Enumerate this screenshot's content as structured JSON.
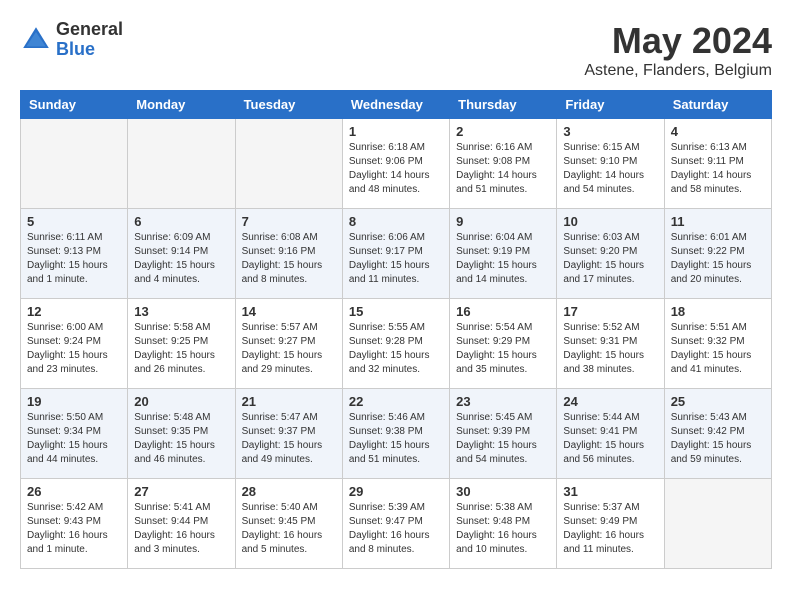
{
  "header": {
    "logo_general": "General",
    "logo_blue": "Blue",
    "month_title": "May 2024",
    "location": "Astene, Flanders, Belgium"
  },
  "days_of_week": [
    "Sunday",
    "Monday",
    "Tuesday",
    "Wednesday",
    "Thursday",
    "Friday",
    "Saturday"
  ],
  "weeks": [
    [
      {
        "day": "",
        "info": ""
      },
      {
        "day": "",
        "info": ""
      },
      {
        "day": "",
        "info": ""
      },
      {
        "day": "1",
        "info": "Sunrise: 6:18 AM\nSunset: 9:06 PM\nDaylight: 14 hours\nand 48 minutes."
      },
      {
        "day": "2",
        "info": "Sunrise: 6:16 AM\nSunset: 9:08 PM\nDaylight: 14 hours\nand 51 minutes."
      },
      {
        "day": "3",
        "info": "Sunrise: 6:15 AM\nSunset: 9:10 PM\nDaylight: 14 hours\nand 54 minutes."
      },
      {
        "day": "4",
        "info": "Sunrise: 6:13 AM\nSunset: 9:11 PM\nDaylight: 14 hours\nand 58 minutes."
      }
    ],
    [
      {
        "day": "5",
        "info": "Sunrise: 6:11 AM\nSunset: 9:13 PM\nDaylight: 15 hours\nand 1 minute."
      },
      {
        "day": "6",
        "info": "Sunrise: 6:09 AM\nSunset: 9:14 PM\nDaylight: 15 hours\nand 4 minutes."
      },
      {
        "day": "7",
        "info": "Sunrise: 6:08 AM\nSunset: 9:16 PM\nDaylight: 15 hours\nand 8 minutes."
      },
      {
        "day": "8",
        "info": "Sunrise: 6:06 AM\nSunset: 9:17 PM\nDaylight: 15 hours\nand 11 minutes."
      },
      {
        "day": "9",
        "info": "Sunrise: 6:04 AM\nSunset: 9:19 PM\nDaylight: 15 hours\nand 14 minutes."
      },
      {
        "day": "10",
        "info": "Sunrise: 6:03 AM\nSunset: 9:20 PM\nDaylight: 15 hours\nand 17 minutes."
      },
      {
        "day": "11",
        "info": "Sunrise: 6:01 AM\nSunset: 9:22 PM\nDaylight: 15 hours\nand 20 minutes."
      }
    ],
    [
      {
        "day": "12",
        "info": "Sunrise: 6:00 AM\nSunset: 9:24 PM\nDaylight: 15 hours\nand 23 minutes."
      },
      {
        "day": "13",
        "info": "Sunrise: 5:58 AM\nSunset: 9:25 PM\nDaylight: 15 hours\nand 26 minutes."
      },
      {
        "day": "14",
        "info": "Sunrise: 5:57 AM\nSunset: 9:27 PM\nDaylight: 15 hours\nand 29 minutes."
      },
      {
        "day": "15",
        "info": "Sunrise: 5:55 AM\nSunset: 9:28 PM\nDaylight: 15 hours\nand 32 minutes."
      },
      {
        "day": "16",
        "info": "Sunrise: 5:54 AM\nSunset: 9:29 PM\nDaylight: 15 hours\nand 35 minutes."
      },
      {
        "day": "17",
        "info": "Sunrise: 5:52 AM\nSunset: 9:31 PM\nDaylight: 15 hours\nand 38 minutes."
      },
      {
        "day": "18",
        "info": "Sunrise: 5:51 AM\nSunset: 9:32 PM\nDaylight: 15 hours\nand 41 minutes."
      }
    ],
    [
      {
        "day": "19",
        "info": "Sunrise: 5:50 AM\nSunset: 9:34 PM\nDaylight: 15 hours\nand 44 minutes."
      },
      {
        "day": "20",
        "info": "Sunrise: 5:48 AM\nSunset: 9:35 PM\nDaylight: 15 hours\nand 46 minutes."
      },
      {
        "day": "21",
        "info": "Sunrise: 5:47 AM\nSunset: 9:37 PM\nDaylight: 15 hours\nand 49 minutes."
      },
      {
        "day": "22",
        "info": "Sunrise: 5:46 AM\nSunset: 9:38 PM\nDaylight: 15 hours\nand 51 minutes."
      },
      {
        "day": "23",
        "info": "Sunrise: 5:45 AM\nSunset: 9:39 PM\nDaylight: 15 hours\nand 54 minutes."
      },
      {
        "day": "24",
        "info": "Sunrise: 5:44 AM\nSunset: 9:41 PM\nDaylight: 15 hours\nand 56 minutes."
      },
      {
        "day": "25",
        "info": "Sunrise: 5:43 AM\nSunset: 9:42 PM\nDaylight: 15 hours\nand 59 minutes."
      }
    ],
    [
      {
        "day": "26",
        "info": "Sunrise: 5:42 AM\nSunset: 9:43 PM\nDaylight: 16 hours\nand 1 minute."
      },
      {
        "day": "27",
        "info": "Sunrise: 5:41 AM\nSunset: 9:44 PM\nDaylight: 16 hours\nand 3 minutes."
      },
      {
        "day": "28",
        "info": "Sunrise: 5:40 AM\nSunset: 9:45 PM\nDaylight: 16 hours\nand 5 minutes."
      },
      {
        "day": "29",
        "info": "Sunrise: 5:39 AM\nSunset: 9:47 PM\nDaylight: 16 hours\nand 8 minutes."
      },
      {
        "day": "30",
        "info": "Sunrise: 5:38 AM\nSunset: 9:48 PM\nDaylight: 16 hours\nand 10 minutes."
      },
      {
        "day": "31",
        "info": "Sunrise: 5:37 AM\nSunset: 9:49 PM\nDaylight: 16 hours\nand 11 minutes."
      },
      {
        "day": "",
        "info": ""
      }
    ]
  ]
}
